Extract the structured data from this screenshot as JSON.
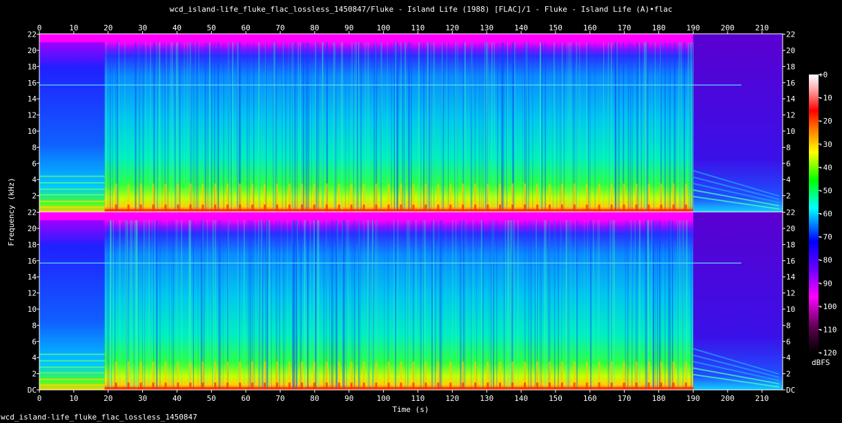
{
  "title": "wcd_island-life_fluke_flac_lossless_1450847/Fluke - Island Life (1988) [FLAC]/1 - Fluke - Island Life (A)•flac",
  "footer": "wcd_island-life_fluke_flac_lossless_1450847",
  "colors": {
    "background": "#000000",
    "text": "#ffffff"
  },
  "chart_data": {
    "type": "heatmap",
    "title": "wcd_island-life_fluke_flac_lossless_1450847/Fluke - Island Life (1988) [FLAC]/1 - Fluke - Island Life (A)•flac",
    "xlabel": "Time (s)",
    "ylabel": "Frequency (kHz)",
    "xlim": [
      0,
      216
    ],
    "ylim": [
      0,
      22.05
    ],
    "x_ticks": [
      "0",
      "10",
      "20",
      "30",
      "40",
      "50",
      "60",
      "70",
      "80",
      "90",
      "100",
      "110",
      "120",
      "130",
      "140",
      "150",
      "160",
      "170",
      "180",
      "190",
      "200",
      "210"
    ],
    "y_ticks": [
      "DC",
      "2",
      "4",
      "6",
      "8",
      "10",
      "12",
      "14",
      "16",
      "18",
      "20",
      "22"
    ],
    "channels": [
      "channel 1",
      "channel 2"
    ],
    "colorbar": {
      "label": "dBFS",
      "ticks": [
        "+0",
        "-10",
        "-20",
        "-30",
        "-40",
        "-50",
        "-60",
        "-70",
        "-80",
        "-90",
        "-100",
        "-110",
        "-120"
      ],
      "range": [
        -120,
        0
      ]
    },
    "features": {
      "quiet_intro_end_s": 19,
      "spectral_cutoff_khz": 21,
      "tone_line_khz": 15.7,
      "fade_out_start_s": 190
    }
  }
}
